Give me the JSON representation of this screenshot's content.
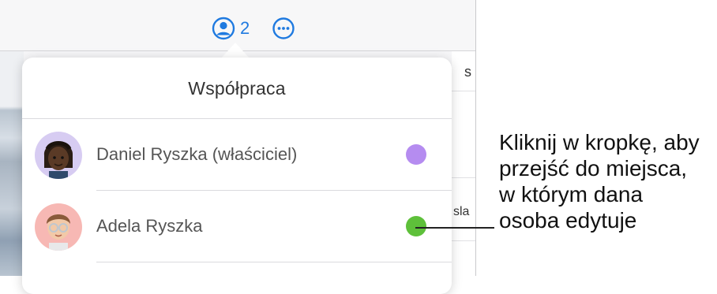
{
  "toolbar": {
    "collaboration_count": "2"
  },
  "background_grid": {
    "header_text": "s",
    "cell_text": "sla"
  },
  "popover": {
    "title": "Współpraca",
    "participants": [
      {
        "name": "Daniel Ryszka (właściciel)",
        "avatar": "memoji-dreadlocks",
        "dot_color": "#b58cf0"
      },
      {
        "name": "Adela Ryszka",
        "avatar": "memoji-glasses",
        "dot_color": "#5ec03a"
      }
    ]
  },
  "callout": {
    "text": "Kliknij w kropkę, aby\nprzejść do miejsca,\nw którym dana\nosoba edytuje"
  }
}
